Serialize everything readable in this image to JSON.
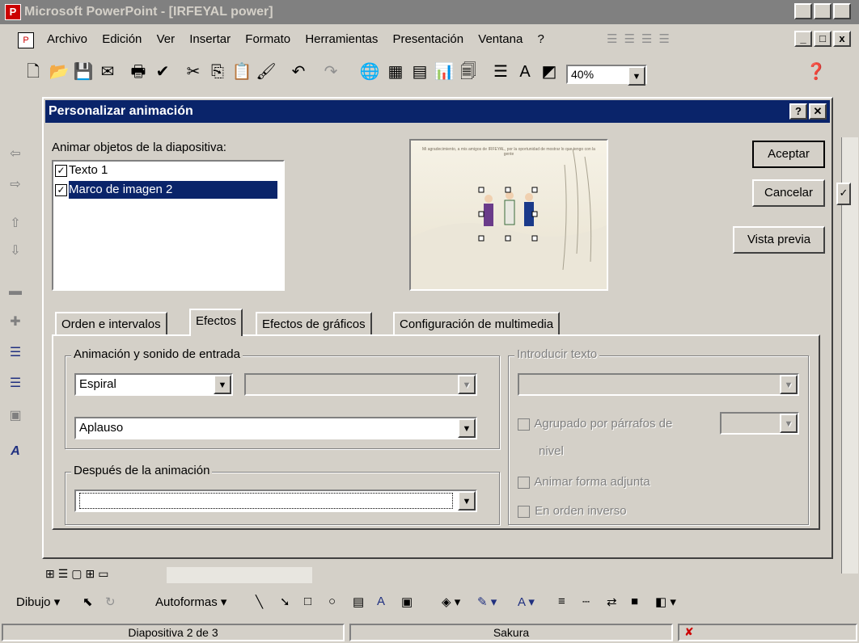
{
  "app": {
    "title": "Microsoft PowerPoint - [IRFEYAL power]",
    "window_buttons": [
      "_",
      "□",
      "x"
    ]
  },
  "menu": [
    {
      "label": "Archivo"
    },
    {
      "label": "Edición"
    },
    {
      "label": "Ver"
    },
    {
      "label": "Insertar"
    },
    {
      "label": "Formato"
    },
    {
      "label": "Herramientas"
    },
    {
      "label": "Presentación"
    },
    {
      "label": "Ventana"
    },
    {
      "label": "?"
    }
  ],
  "toolbar": {
    "zoom": "40%"
  },
  "dialog": {
    "title": "Personalizar animación",
    "help_btn": "?",
    "close_btn": "✕",
    "objects_label": "Animar objetos de la diapositiva:",
    "objects": [
      {
        "label": "Texto 1",
        "checked": true,
        "selected": false
      },
      {
        "label": "Marco de imagen 2",
        "checked": true,
        "selected": true
      }
    ],
    "buttons": {
      "ok": "Aceptar",
      "cancel": "Cancelar",
      "preview": "Vista previa"
    },
    "tabs": [
      {
        "label": "Orden e intervalos",
        "active": false
      },
      {
        "label": "Efectos",
        "active": true
      },
      {
        "label": "Efectos de gráficos",
        "active": false
      },
      {
        "label": "Configuración de multimedia",
        "active": false
      }
    ],
    "entry_group": {
      "label": "Animación y sonido de entrada",
      "effect": "Espiral",
      "direction": "",
      "sound": "Aplauso"
    },
    "after_group": {
      "label": "Después de la animación",
      "value": ""
    },
    "text_group": {
      "label": "Introducir texto",
      "value": "",
      "grouped_label": "Agrupado por párrafos de",
      "grouped_label2": "nivel",
      "animate_shape": "Animar forma adjunta",
      "reverse": "En orden inverso"
    }
  },
  "slide_preview": {
    "caption": "Mi agradecimiento, a mis amigos de IRFEYAL, por la oportunidad de mostrar lo que tengo con la gente"
  },
  "slide_controls": {
    "check_mark": "✓"
  },
  "drawing_toolbar": {
    "draw": "Dibujo",
    "autoshapes": "Autoformas"
  },
  "status": {
    "slide": "Diapositiva 2 de 3",
    "design": "Sakura"
  },
  "colors": {
    "title_active": "#0a246a",
    "title_inactive": "#808080",
    "face": "#d4d0c8",
    "selection": "#0a246a"
  }
}
